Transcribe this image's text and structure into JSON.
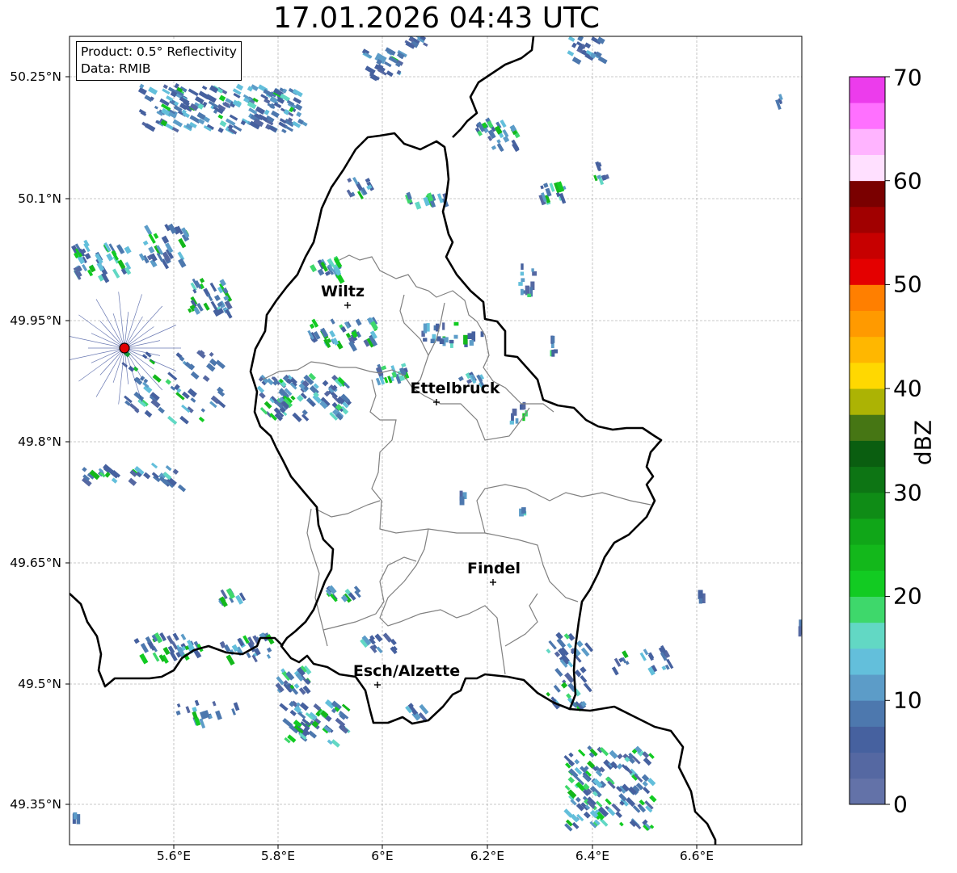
{
  "title": "17.01.2026 04:43 UTC",
  "info": {
    "product": "Product: 0.5° Reflectivity",
    "data": "Data: RMIB"
  },
  "lat_ticks": [
    "50.25°N",
    "50.1°N",
    "49.95°N",
    "49.8°N",
    "49.65°N",
    "49.5°N",
    "49.35°N"
  ],
  "lon_ticks": [
    "5.6°E",
    "5.8°E",
    "6°E",
    "6.2°E",
    "6.4°E",
    "6.6°E"
  ],
  "colorbar": {
    "label": "dBZ",
    "ticks": [
      "0",
      "10",
      "20",
      "30",
      "40",
      "50",
      "60",
      "70"
    ],
    "colors": [
      "#6372a8",
      "#5568a2",
      "#46619f",
      "#4d78ae",
      "#5c9cc8",
      "#63bfdb",
      "#62d8c4",
      "#3ed86b",
      "#12cb22",
      "#13b81b",
      "#10a618",
      "#0f8c16",
      "#0d7514",
      "#0a5e10",
      "#467614",
      "#acb304",
      "#ffd801",
      "#ffb700",
      "#ff9a00",
      "#ff7f00",
      "#e40000",
      "#c70000",
      "#a10000",
      "#7a0000",
      "#ffe0ff",
      "#ffb4ff",
      "#ff70ff",
      "#ec3cec"
    ]
  },
  "cities": [
    {
      "name": "Wiltz"
    },
    {
      "name": "Ettelbruck"
    },
    {
      "name": "Findel"
    },
    {
      "name": "Esch/Alzette"
    }
  ],
  "radar_site_color": "#e00000"
}
